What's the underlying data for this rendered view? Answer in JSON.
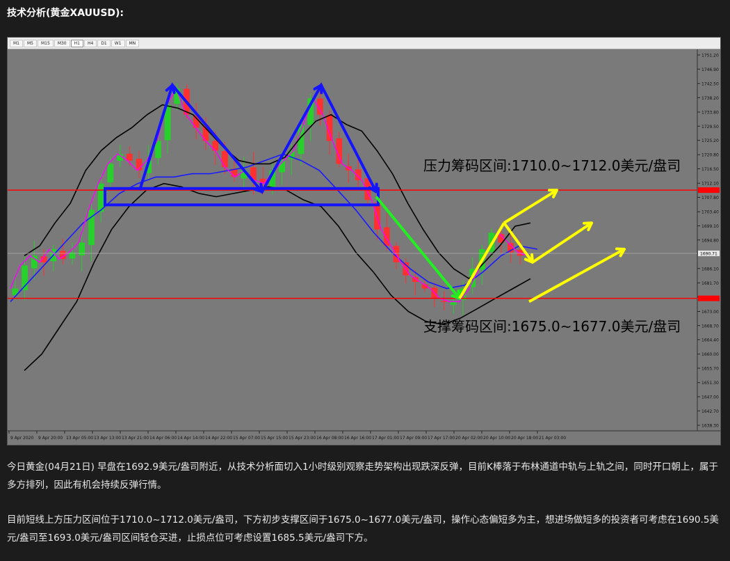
{
  "heading": "技术分析(黄金XAUUSD):",
  "timeframes": [
    "M1",
    "M5",
    "M15",
    "M30",
    "H1",
    "H4",
    "D1",
    "W1",
    "MN"
  ],
  "active_timeframe": "H1",
  "colors": {
    "background": "#7a7a7a",
    "bull_candle": "#27d02b",
    "bear_candle": "#ff3030",
    "bollinger": "#000000",
    "ma_fast": "#ff00ff",
    "ma_slow": "#1a1aff",
    "level_line": "#ff0000",
    "pattern": "#1414ff",
    "down_arrow": "#22ee22",
    "up_arrows": "#ffff00"
  },
  "chart_data": {
    "type": "line",
    "instrument": "XAUUSD",
    "timeframe": "H1",
    "y_ticks": [
      "1751.20",
      "1746.90",
      "1742.50",
      "1738.20",
      "1733.80",
      "1729.50",
      "1725.20",
      "1720.80",
      "1716.50",
      "1712.10",
      "1707.80",
      "1703.40",
      "1699.10",
      "1694.80",
      "1690.71",
      "1686.10",
      "1681.70",
      "1677.40",
      "1673.00",
      "1668.70",
      "1664.40",
      "1660.00",
      "1655.70",
      "1651.30",
      "1647.00",
      "1642.70",
      "1638.30"
    ],
    "ylim": [
      1638.3,
      1751.2
    ],
    "x_ticks": [
      "9 Apr 2020",
      "9 Apr 20:00",
      "13 Apr 05:00",
      "13 Apr 13:00",
      "13 Apr 21:00",
      "14 Apr 06:00",
      "14 Apr 14:00",
      "14 Apr 22:00",
      "15 Apr 07:00",
      "15 Apr 15:00",
      "15 Apr 23:00",
      "16 Apr 08:00",
      "16 Apr 16:00",
      "17 Apr 01:00",
      "17 Apr 09:00",
      "17 Apr 17:00",
      "20 Apr 02:00",
      "20 Apr 10:00",
      "20 Apr 18:00",
      "21 Apr 03:00"
    ],
    "current_price": "1690.71",
    "resistance": 1710.0,
    "support": 1677.0,
    "resistance_label": "压力筹码区间:1710.0~1712.0美元/盘司",
    "support_label": "支撑筹码区间:1675.0~1677.0美元/盘司",
    "series": [
      {
        "values": [
          1680,
          1687,
          1690,
          1688,
          1692,
          1689,
          1691,
          1694,
          1704,
          1712,
          1718,
          1721,
          1719,
          1716,
          1719,
          1725,
          1736,
          1741,
          1733,
          1729,
          1725,
          1722,
          1717,
          1714,
          1716,
          1713,
          1712,
          1716,
          1719,
          1722,
          1730,
          1738,
          1733,
          1725,
          1718,
          1716,
          1713,
          1707,
          1698,
          1693,
          1688,
          1684,
          1682,
          1680,
          1677,
          1676,
          1676,
          1680,
          1686,
          1692,
          1697,
          1694,
          1691,
          1690
        ]
      },
      {
        "values": [
          1690,
          1693,
          1700,
          1706,
          1716,
          1722,
          1726,
          1729,
          1733,
          1736,
          1735,
          1733,
          1728,
          1723,
          1719,
          1718,
          1718,
          1720,
          1726,
          1731,
          1733,
          1730,
          1728,
          1722,
          1715,
          1706,
          1698,
          1691,
          1686,
          1683,
          1688,
          1693,
          1699,
          1700
        ]
      },
      {
        "values": [
          1655,
          1660,
          1668,
          1676,
          1688,
          1698,
          1705,
          1710,
          1712,
          1711,
          1709,
          1708,
          1709,
          1710,
          1711,
          1710,
          1707,
          1705,
          1699,
          1691,
          1685,
          1678,
          1673,
          1670,
          1669,
          1671,
          1674,
          1677,
          1680,
          1683
        ]
      },
      {
        "values": [
          1676,
          1682,
          1688,
          1694,
          1700,
          1704,
          1709,
          1712,
          1714,
          1714,
          1715,
          1715,
          1716,
          1717,
          1719,
          1721,
          1719,
          1716,
          1710,
          1704,
          1697,
          1691,
          1686,
          1682,
          1680,
          1681,
          1685,
          1690,
          1693,
          1692
        ]
      }
    ]
  },
  "paragraph1": "今日黄金(04月21日) 早盘在1692.9美元/盎司附近，从技术分析面切入1小时级别观察走势架构出现跌深反弹，目前K棒落于布林通道中轨与上轨之间，同时开口朝上，属于多方排列，因此有机会持续反弹行情。",
  "paragraph2": "目前短线上方压力区间位于1710.0~1712.0美元/盎司，下方初步支撑区间于1675.0~1677.0美元/盎司，操作心态偏短多为主，想进场做短多的投资者可考虑在1690.5美元/盎司至1693.0美元/盎司区间轻仓买进，止损点位可考虑设置1685.5美元/盎司下方。"
}
